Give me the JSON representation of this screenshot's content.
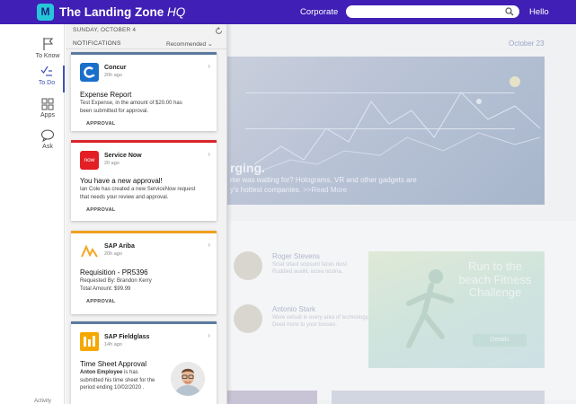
{
  "header": {
    "title_main": "The Landing Zone",
    "title_suffix": "HQ",
    "logo_letter": "M",
    "corporate_link": "Corporate",
    "greeting": "Hello"
  },
  "nav": {
    "items": [
      {
        "label": "To Know",
        "icon": "flag-icon"
      },
      {
        "label": "To Do",
        "icon": "checklist-icon"
      },
      {
        "label": "Apps",
        "icon": "apps-grid-icon"
      },
      {
        "label": "Ask",
        "icon": "chat-icon"
      }
    ],
    "active": "To Do",
    "activity_label": "Activity"
  },
  "background": {
    "date": "October 23",
    "hero_title": "rging.",
    "hero_line1": "me was waiting for? Holograms, VR and other gadgets are",
    "hero_line2": "y's hottest companies.",
    "read_more": ">>Read More",
    "people": [
      {
        "name": "Roger Stevens",
        "desc1": "Sciat sitaut scipsunt faces duisi",
        "desc2": "Ruddled auxilit, iocea nostria."
      },
      {
        "name": "Antonio Stark",
        "desc1": "Were velsuit in every area of technology.",
        "desc2": "Deed more to your bosses."
      }
    ],
    "promo": {
      "title": "Run to the beach Fitness Challenge",
      "button": "Details"
    }
  },
  "panel": {
    "date": "SUNDAY, OCTOBER 4",
    "title": "NOTIFICATIONS",
    "sort": "Recommended",
    "cards": [
      {
        "app": "Concur",
        "time": "20h ago",
        "accent": "#5b7a9e",
        "logo_color": "#1a6fc9",
        "logo_text": "C",
        "title": "Expense Report",
        "body": [
          "Test Expense, in the amount of $20.00 has",
          "been submitted for approval."
        ],
        "action": "APPROVAL"
      },
      {
        "app": "Service Now",
        "time": "20 ago",
        "accent": "#d9262c",
        "logo_color": "#e31e24",
        "logo_text": "now",
        "title": "You have a new approval!",
        "body": [
          "Ian Cole has created a new ServiceNow request",
          "that needs your review and approval."
        ],
        "action": "APPROVAL"
      },
      {
        "app": "SAP Ariba",
        "time": "20h ago",
        "accent": "#f0a020",
        "logo_color": "#ffffff",
        "logo_text": "",
        "title": "Requisition - PR5396",
        "body": [
          "Requested By: Brandon Kerry",
          "Total Amount: $99.99"
        ],
        "action": "APPROVAL"
      },
      {
        "app": "SAP Fieldglass",
        "time": "14h ago",
        "accent": "#5b7a9e",
        "logo_color": "#f5a800",
        "logo_text": "",
        "title": "Time Sheet Approval",
        "body_bold": "Anton Employee",
        "body": [
          " is has",
          "submitted his time sheet for the",
          "period ending 10/02/2020 ."
        ],
        "action": ""
      }
    ]
  }
}
